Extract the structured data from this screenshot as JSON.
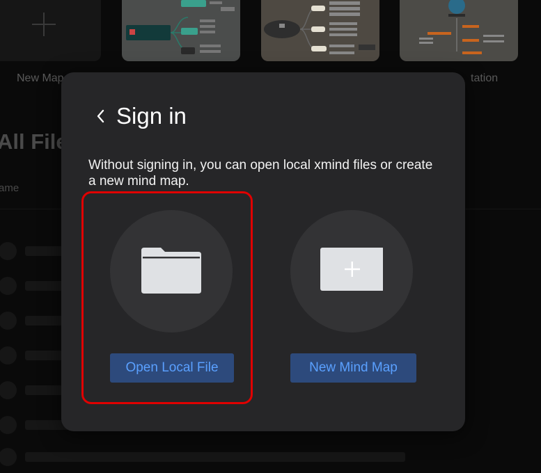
{
  "background": {
    "new_map_label": "New Map",
    "presentation_label": "tation",
    "section_title": "All Files",
    "column_name": "ame"
  },
  "modal": {
    "title": "Sign in",
    "description": "Without signing in, you can open local xmind files or create a new mind map.",
    "open_local_file_label": "Open Local File",
    "new_mind_map_label": "New Mind Map",
    "back_icon": "chevron-left-icon",
    "folder_icon": "folder-icon",
    "new_map_icon": "add-map-icon"
  },
  "colors": {
    "modal_bg": "#262628",
    "button_bg": "#2d4a7c",
    "button_text": "#5aa0ff",
    "highlight": "#e00000"
  }
}
